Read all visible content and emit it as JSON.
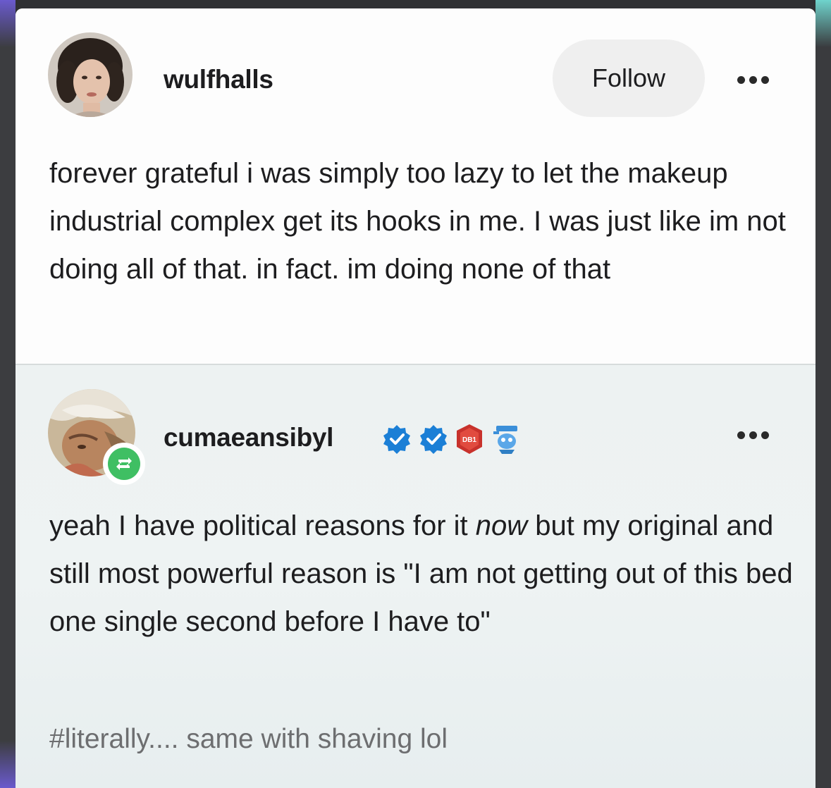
{
  "original_post": {
    "username": "wulfhalls",
    "follow_label": "Follow",
    "text": "forever grateful i was simply too lazy to let the makeup industrial complex get its hooks in me. I was just like im not doing all of that. in fact. im doing none of that"
  },
  "reblog": {
    "username": "cumaeansibyl",
    "text_before": "yeah I have political reasons for it ",
    "text_emphasis": "now",
    "text_after": " but my original and still most powerful reason is \"I am not getting out of this bed one single second before I have to\"",
    "tags": "#literally.... same with shaving lol",
    "badges": [
      "verified-check-icon",
      "verified-check-icon",
      "red-shield-badge-icon",
      "blue-mascot-badge-icon"
    ],
    "badge_text": "DB1"
  },
  "colors": {
    "reblog_green": "#3fbf63",
    "verified_blue": "#1b7fd6",
    "shield_red": "#c8322c"
  }
}
